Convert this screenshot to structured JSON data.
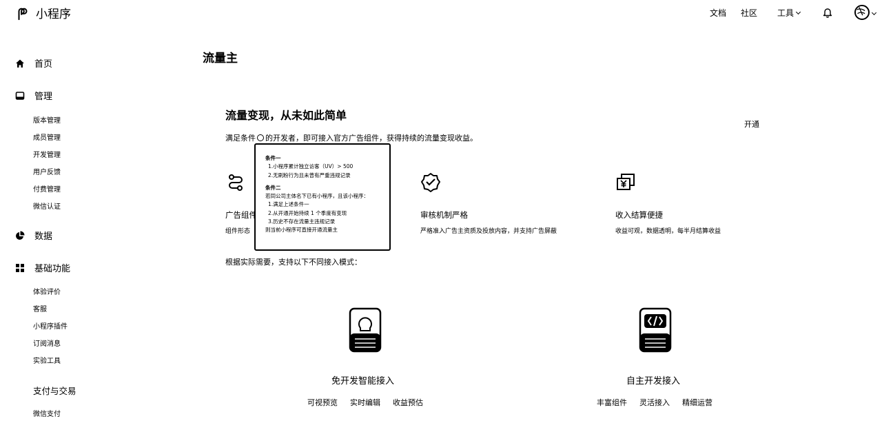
{
  "app": {
    "title": "小程序"
  },
  "header": {
    "nav": [
      {
        "label": "文档"
      },
      {
        "label": "社区"
      },
      {
        "label": "工具"
      }
    ]
  },
  "sidebar": {
    "groups": [
      {
        "label": "首页",
        "icon": "home-icon"
      },
      {
        "label": "管理",
        "icon": "inbox-icon",
        "items": [
          "版本管理",
          "成员管理",
          "开发管理",
          "用户反馈",
          "付费管理",
          "微信认证"
        ]
      },
      {
        "label": "数据",
        "icon": "pie-chart-icon"
      },
      {
        "label": "基础功能",
        "icon": "grid-icon",
        "items": [
          "体验评价",
          "客服",
          "小程序插件",
          "订阅消息",
          "实验工具"
        ]
      },
      {
        "label": "支付与交易",
        "items": [
          "微信支付"
        ]
      }
    ]
  },
  "main": {
    "page_title": "流量主",
    "hero_title": "流量变现，从未如此简单",
    "hero_desc_pre": "满足条件",
    "hero_desc_post": "的开发者，即可接入官方广告组件，获得持续的流量变现收益。",
    "right_mark": "开通",
    "features": [
      {
        "title": "广告组件",
        "desc": "组件形态",
        "icon": "flow-icon"
      },
      {
        "title": "审核机制严格",
        "desc": "严格准入广告主资质及投放内容，并支持广告屏蔽",
        "icon": "shield-check-icon"
      },
      {
        "title": "收入结算便捷",
        "desc": "收益可观，数据透明，每半月结算收益",
        "icon": "yuan-icon"
      }
    ],
    "modes_label": "根据实际需要，支持以下不同接入模式：",
    "modes": [
      {
        "title": "免开发智能接入",
        "icon": "lightbulb-icon",
        "tags": [
          "可视预览",
          "实时编辑",
          "收益预估"
        ]
      },
      {
        "title": "自主开发接入",
        "icon": "code-icon",
        "tags": [
          "丰富组件",
          "灵活接入",
          "精细运营"
        ]
      }
    ]
  },
  "tooltip": {
    "cond1_title": "条件一",
    "cond1_lines": [
      "1.小程序累计独立访客（UV）> 500",
      "2.无刷粉行为且未曾有严重违规记录"
    ],
    "cond2_title": "条件二",
    "cond2_lines": [
      "若同公司主体名下已有小程序，且该小程序：",
      "1.满足上述条件一",
      "2.从开通开始持续 1 个季度有变现",
      "3.历史不存在流量主违规记录",
      "则当前小程序可直接开通流量主"
    ]
  }
}
